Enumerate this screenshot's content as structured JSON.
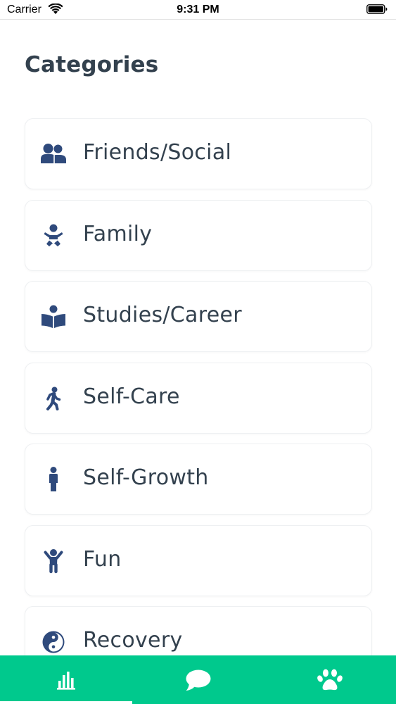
{
  "status_bar": {
    "carrier": "Carrier",
    "time": "9:31 PM"
  },
  "page": {
    "title": "Categories"
  },
  "categories": [
    {
      "label": "Friends/Social",
      "icon": "user-friends-icon"
    },
    {
      "label": "Family",
      "icon": "baby-icon"
    },
    {
      "label": "Studies/Career",
      "icon": "book-reader-icon"
    },
    {
      "label": "Self-Care",
      "icon": "walking-icon"
    },
    {
      "label": "Self-Growth",
      "icon": "male-icon"
    },
    {
      "label": "Fun",
      "icon": "child-icon"
    },
    {
      "label": "Recovery",
      "icon": "yin-yang-icon"
    }
  ],
  "tab_bar": {
    "tabs": [
      {
        "icon": "bar-chart-icon",
        "active": true
      },
      {
        "icon": "chat-bubble-icon",
        "active": false
      },
      {
        "icon": "paw-icon",
        "active": false
      }
    ]
  },
  "colors": {
    "accent": "#00c98d",
    "icon": "#2f4a7c",
    "text": "#33414e"
  }
}
